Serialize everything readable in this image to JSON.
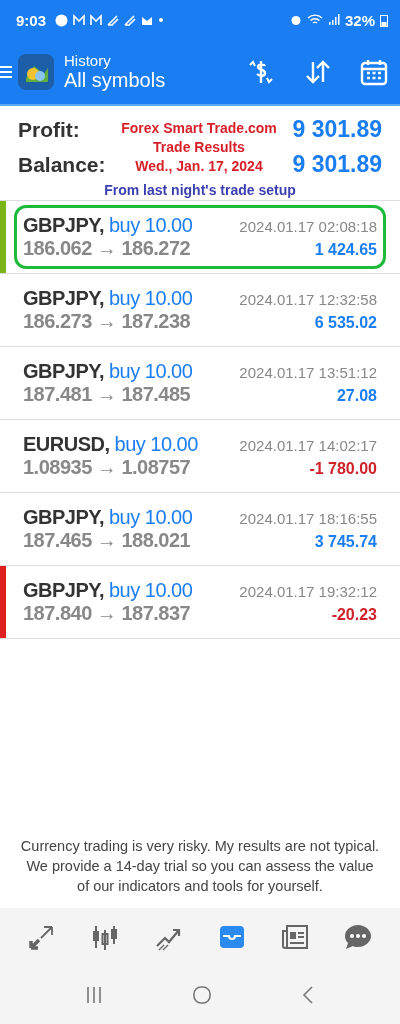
{
  "status_bar": {
    "time": "9:03",
    "battery": "32%"
  },
  "app_bar": {
    "title": "History",
    "subtitle": "All symbols"
  },
  "summary": {
    "profit_label": "Profit:",
    "profit": "9 301.89",
    "balance_label": "Balance:",
    "balance": "9 301.89"
  },
  "annotation": {
    "lines": [
      "Forex Smart Trade.com",
      "Trade Results",
      "Wed., Jan. 17, 2024"
    ],
    "note": "From last night's trade setup"
  },
  "trades": [
    {
      "symbol": "GBPJPY,",
      "side": "buy 10.00",
      "prices": "186.062 → 186.272",
      "time": "2024.01.17 02:08:18",
      "result": "1 424.65",
      "negative": false,
      "highlighted": true,
      "color": "#7cb518"
    },
    {
      "symbol": "GBPJPY,",
      "side": "buy 10.00",
      "prices": "186.273 → 187.238",
      "time": "2024.01.17 12:32:58",
      "result": "6 535.02",
      "negative": false,
      "highlighted": false
    },
    {
      "symbol": "GBPJPY,",
      "side": "buy 10.00",
      "prices": "187.481 → 187.485",
      "time": "2024.01.17 13:51:12",
      "result": "27.08",
      "negative": false,
      "highlighted": false
    },
    {
      "symbol": "EURUSD,",
      "side": "buy 10.00",
      "prices": "1.08935 → 1.08757",
      "time": "2024.01.17 14:02:17",
      "result": "-1 780.00",
      "negative": true,
      "highlighted": false
    },
    {
      "symbol": "GBPJPY,",
      "side": "buy 10.00",
      "prices": "187.465 → 188.021",
      "time": "2024.01.17 18:16:55",
      "result": "3 745.74",
      "negative": false,
      "highlighted": false
    },
    {
      "symbol": "GBPJPY,",
      "side": "buy 10.00",
      "prices": "187.840 → 187.837",
      "time": "2024.01.17 19:32:12",
      "result": "-20.23",
      "negative": true,
      "highlighted": false,
      "color": "#e02020"
    }
  ],
  "disclaimer": "Currency trading is very risky. My results are not typical. We provide a 14-day trial so you can assess the value of our indicators and tools for yourself.",
  "bottom_nav": [
    {
      "kind": "trade",
      "selected": false
    },
    {
      "kind": "chart",
      "selected": false
    },
    {
      "kind": "trend",
      "selected": false
    },
    {
      "kind": "history",
      "selected": true
    },
    {
      "kind": "news",
      "selected": false
    },
    {
      "kind": "chat",
      "selected": false
    }
  ]
}
